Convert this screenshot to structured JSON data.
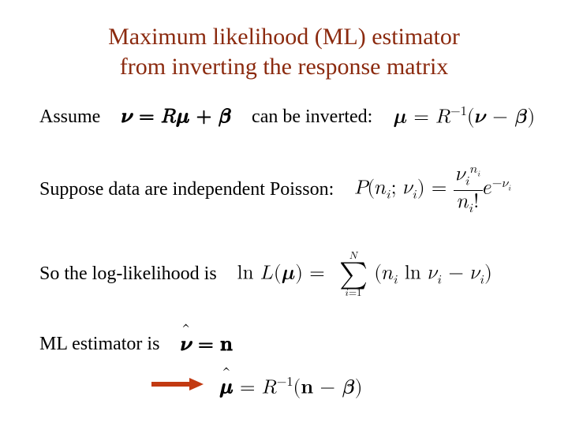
{
  "title_line1": "Maximum likelihood (ML) estimator",
  "title_line2": "from inverting the response matrix",
  "line1": {
    "t1": "Assume",
    "eq1": "𝝂 = 𝑅𝝁 + 𝜷",
    "t2": "can be inverted:",
    "eq2_lhs": "𝝁 = 𝑅",
    "eq2_sup": "−1",
    "eq2_rhs": "(𝝂 − 𝜷)"
  },
  "line2": {
    "t1": "Suppose data are independent Poisson:",
    "P": "𝑃(𝑛",
    "sub_i1": "𝑖",
    "semi": "; 𝜈",
    "close": ") =",
    "num_base": "𝜈",
    "num_sup": "𝑛",
    "den_base": "𝑛",
    "den_fact": "!",
    "e": "𝑒",
    "e_sup_neg": "−𝜈",
    "sub_i": "𝑖"
  },
  "line3": {
    "t1": "So the log-likelihood is",
    "lhs": "ln 𝐿(𝝁) =",
    "sum_top": "𝑁",
    "sum_bot": "𝑖=1",
    "body_open": "(𝑛",
    "body_mid": " ln 𝜈",
    "body_minus": " − 𝜈",
    "body_close": ")",
    "sub_i": "𝑖"
  },
  "line4": {
    "t1": "ML estimator is",
    "eq_nu": "𝝂",
    "eq_n": " = 𝐧"
  },
  "line5": {
    "mu": "𝝁",
    "eq": " = 𝑅",
    "sup": "−1",
    "rhs": "(𝐧 − 𝜷)"
  }
}
